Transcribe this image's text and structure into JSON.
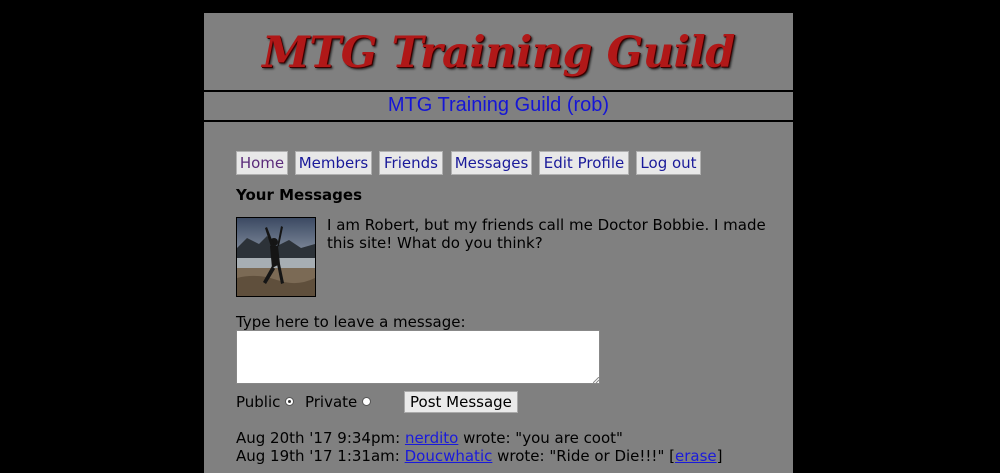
{
  "site": {
    "logo_text": "MTG Training Guild",
    "subtitle": "MTG Training Guild (rob)"
  },
  "nav": {
    "home": "Home",
    "members": "Members",
    "friends": "Friends",
    "messages": "Messages",
    "edit_profile": "Edit Profile",
    "log_out": "Log out"
  },
  "profile": {
    "heading": "Your Messages",
    "bio": "I am Robert, but my friends call me Doctor Bobbie. I made this site! What do you think?"
  },
  "compose": {
    "prompt": "Type here to leave a message:",
    "value": "",
    "public_label": "Public",
    "private_label": "Private",
    "selected": "Public",
    "post_label": "Post Message"
  },
  "messages": [
    {
      "date": "Aug 20th '17 9:34pm:",
      "author": "nerdito",
      "body": " wrote: \"you are coot\""
    },
    {
      "date": "Aug 19th '17 1:31am:",
      "author": "Doucwhatic",
      "body": " wrote: \"Ride or Die!!!\" ",
      "erase_label": "erase"
    }
  ],
  "colors": {
    "page_bg": "#808080",
    "outer_bg": "#000000",
    "logo": "#b01818",
    "subtitle": "#1515d6",
    "link": "#1a1adb"
  }
}
